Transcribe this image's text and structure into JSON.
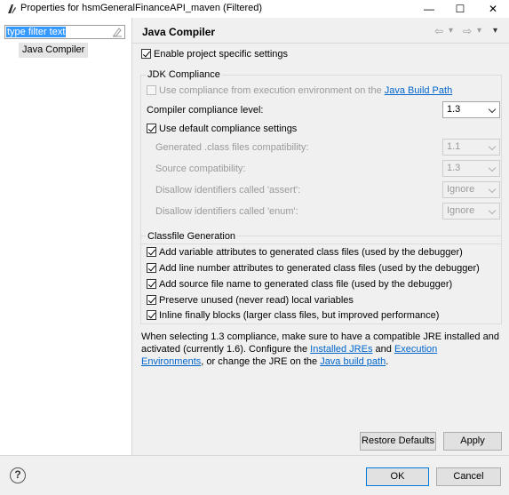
{
  "window": {
    "title": "Properties for hsmGeneralFinanceAPI_maven (Filtered)",
    "minimize": "—",
    "maximize": "☐",
    "close": "✕"
  },
  "sidebar": {
    "filter_value": "type filter text",
    "items": [
      {
        "label": "Java Compiler"
      }
    ]
  },
  "page": {
    "title": "Java Compiler",
    "nav": {
      "back": "⇦",
      "back_menu": "▾",
      "forward": "⇨",
      "forward_menu": "▾",
      "view_menu": "▾"
    },
    "enable_project_specific": {
      "label": "Enable project specific settings",
      "checked": true
    },
    "jdk_compliance": {
      "group_label": "JDK Compliance",
      "use_ee_prefix": "Use compliance from execution environment on the ",
      "use_ee_link": "Java Build Path",
      "compliance_level_label": "Compiler compliance level:",
      "compliance_level_value": "1.3",
      "use_default_label": "Use default compliance settings",
      "generated_class_label": "Generated .class files compatibility:",
      "generated_class_value": "1.1",
      "source_compat_label": "Source compatibility:",
      "source_compat_value": "1.3",
      "assert_label": "Disallow identifiers called 'assert':",
      "assert_value": "Ignore",
      "enum_label": "Disallow identifiers called 'enum':",
      "enum_value": "Ignore"
    },
    "classfile_generation": {
      "group_label": "Classfile Generation",
      "options": [
        "Add variable attributes to generated class files (used by the debugger)",
        "Add line number attributes to generated class files (used by the debugger)",
        "Add source file name to generated class file (used by the debugger)",
        "Preserve unused (never read) local variables",
        "Inline finally blocks (larger class files, but improved performance)"
      ]
    },
    "info": {
      "text1": "When selecting 1.3 compliance, make sure to have a compatible JRE installed and activated (currently 1.6). Configure the ",
      "link1": "Installed JREs",
      "text2": " and ",
      "link2": "Execution Environments",
      "text3": ", or change the JRE on the ",
      "link3": "Java build path",
      "text4": "."
    },
    "restore_defaults": "Restore Defaults",
    "apply": "Apply"
  },
  "footer": {
    "help": "?",
    "ok": "OK",
    "cancel": "Cancel"
  }
}
